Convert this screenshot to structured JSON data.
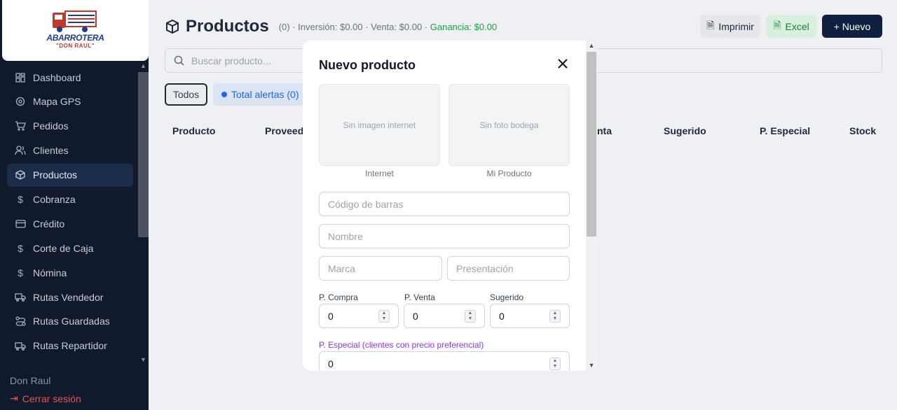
{
  "brand": {
    "name": "ABARROTERA",
    "subtitle": "\"DON RAUL\""
  },
  "sidebar": {
    "items": [
      {
        "label": "Dashboard",
        "icon": "dashboard-icon"
      },
      {
        "label": "Mapa GPS",
        "icon": "map-pin-icon"
      },
      {
        "label": "Pedidos",
        "icon": "cart-icon"
      },
      {
        "label": "Clientes",
        "icon": "users-icon"
      },
      {
        "label": "Productos",
        "icon": "box-icon",
        "active": true
      },
      {
        "label": "Cobranza",
        "icon": "dollar-icon"
      },
      {
        "label": "Crédito",
        "icon": "credit-card-icon"
      },
      {
        "label": "Corte de Caja",
        "icon": "dollar-icon"
      },
      {
        "label": "Nómina",
        "icon": "dollar-icon"
      },
      {
        "label": "Rutas Vendedor",
        "icon": "truck-icon"
      },
      {
        "label": "Rutas Guardadas",
        "icon": "route-icon"
      },
      {
        "label": "Rutas Repartidor",
        "icon": "truck-icon"
      }
    ],
    "user": "Don Raul",
    "logout": "Cerrar sesión"
  },
  "header": {
    "title": "Productos",
    "stats": "(0) · Inversión: $0.00 · Venta: $0.00 · ",
    "gain": "Ganancia: $0.00",
    "print_label": "Imprimir",
    "excel_label": "Excel",
    "new_label": "+ Nuevo"
  },
  "search": {
    "placeholder": "Buscar producto..."
  },
  "filters": {
    "all": "Todos",
    "alerts": "Total alertas (0)"
  },
  "table": {
    "columns": [
      "Producto",
      "Proveedor",
      "Venta",
      "Sugerido",
      "P. Especial",
      "Stock"
    ],
    "visible_columns": {
      "producto": "Producto",
      "proveedor": "Proveed",
      "venta": "nta",
      "sugerido": "Sugerido",
      "especial": "P. Especial",
      "stock": "Stock"
    }
  },
  "modal": {
    "title": "Nuevo producto",
    "image_internet": "Sin imagen internet",
    "image_bodega": "Sin foto bodega",
    "caption_internet": "Internet",
    "caption_bodega": "Mi Producto",
    "barcode_placeholder": "Código de barras",
    "name_placeholder": "Nombre",
    "brand_placeholder": "Marca",
    "presentation_placeholder": "Presentación",
    "p_compra_label": "P. Compra",
    "p_compra_value": "0",
    "p_venta_label": "P. Venta",
    "p_venta_value": "0",
    "sugerido_label": "Sugerido",
    "sugerido_value": "0",
    "p_especial_label": "P. Especial (clientes con precio preferencial)",
    "p_especial_value": "0"
  },
  "colors": {
    "sidebar_bg": "#111a2c",
    "accent_new": "#0f1f3d",
    "gain": "#16a34a",
    "special": "#9333ea"
  }
}
